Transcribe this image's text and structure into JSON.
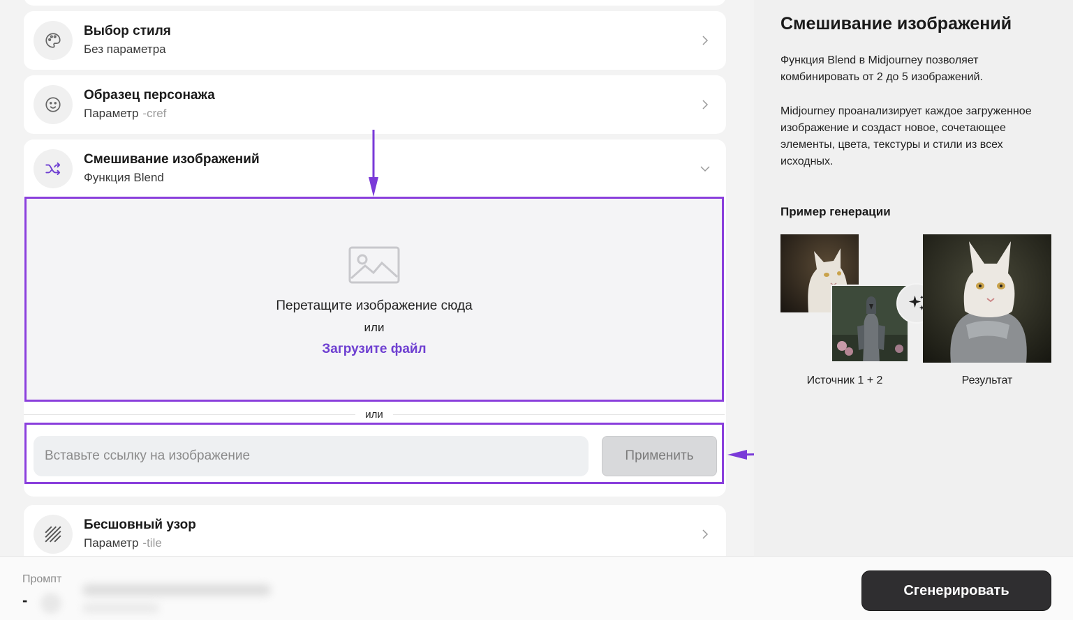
{
  "options": [
    {
      "title": "Выбор стиля",
      "subtitle": "Без параметра",
      "param": "",
      "icon": "palette-icon"
    },
    {
      "title": "Образец персонажа",
      "subtitle": "Параметр",
      "param": "-cref",
      "icon": "smiley-icon"
    },
    {
      "title": "Смешивание изображений",
      "subtitle": "Функция Blend",
      "param": "",
      "icon": "shuffle-icon"
    },
    {
      "title": "Бесшовный узор",
      "subtitle": "Параметр",
      "param": "-tile",
      "icon": "pattern-icon"
    }
  ],
  "dropzone": {
    "drag_text": "Перетащите изображение сюда",
    "or_text": "или",
    "upload_link": "Загрузите файл"
  },
  "divider_or": "или",
  "url_input": {
    "placeholder": "Вставьте ссылку на изображение",
    "value": ""
  },
  "apply_button": "Применить",
  "info": {
    "title": "Смешивание изображений",
    "paragraph1": "Функция Blend в Midjourney позволяет комбинировать от 2 до 5 изображений.",
    "paragraph2": "Midjourney проанализирует каждое загруженное изображение и создаст новое, сочетающее элементы, цвета, текстуры и стили из всех исходных.",
    "example_heading": "Пример генерации",
    "source_caption": "Источник 1 + 2",
    "result_caption": "Результат"
  },
  "bottom": {
    "prompt_label": "Промпт",
    "prompt_value": "-",
    "generate_button": "Сгенерировать"
  },
  "colors": {
    "accent": "#8a3fdc",
    "link": "#6e3fd1",
    "button_dark": "#2f2e30"
  }
}
